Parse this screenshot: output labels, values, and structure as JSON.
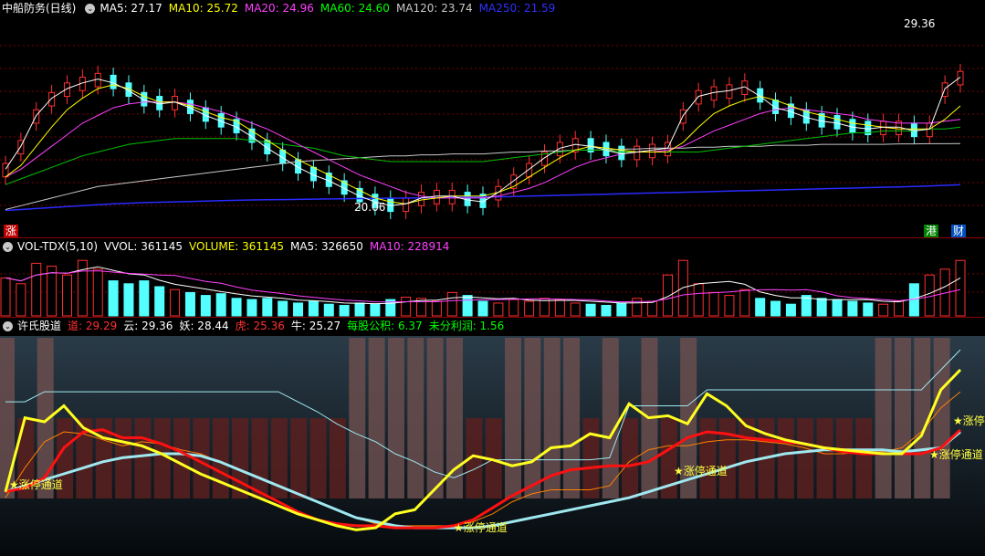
{
  "price_panel": {
    "stock": "中船防务(日线)",
    "ma": [
      {
        "label": "MA5: 27.17",
        "color": "#ffffff"
      },
      {
        "label": "MA10: 25.72",
        "color": "#ffff00"
      },
      {
        "label": "MA20: 24.96",
        "color": "#ff40ff"
      },
      {
        "label": "MA60: 24.60",
        "color": "#00ff00"
      },
      {
        "label": "MA120: 23.74",
        "color": "#c8c8c8"
      },
      {
        "label": "MA250: 21.59",
        "color": "#3030ff"
      }
    ],
    "high_label": "29.36",
    "low_label": "20.06",
    "tag_zhang": "涨",
    "tag_gang": "港",
    "tag_cai": "财"
  },
  "vol_panel": {
    "title": "VOL-TDX(5,10)",
    "items": [
      {
        "label": "VVOL: 361145",
        "color": "#ffffff"
      },
      {
        "label": "VOLUME: 361145",
        "color": "#ffff00"
      },
      {
        "label": "MA5: 326650",
        "color": "#ffffff"
      },
      {
        "label": "MA10: 228914",
        "color": "#ff40ff"
      }
    ]
  },
  "ind_panel": {
    "title": "许氏股道",
    "items": [
      {
        "label": "道: 29.29",
        "color": "#ff3030"
      },
      {
        "label": "云: 29.36",
        "color": "#ffffff"
      },
      {
        "label": "妖: 28.44",
        "color": "#ffffff"
      },
      {
        "label": "虎: 25.36",
        "color": "#ff3030"
      },
      {
        "label": "牛: 25.27",
        "color": "#ffffff"
      },
      {
        "label": "每股公积: 6.37",
        "color": "#00ff00"
      },
      {
        "label": "未分利润: 1.56",
        "color": "#00ff00"
      }
    ],
    "signal_label": "★涨停通道"
  },
  "chart_data": {
    "type": "line",
    "price": {
      "ma5": [
        22.4,
        23.6,
        25.2,
        26.1,
        26.6,
        26.9,
        27.1,
        26.9,
        26.5,
        26.0,
        25.8,
        25.9,
        25.6,
        25.2,
        24.9,
        24.6,
        24.1,
        23.5,
        23.0,
        22.5,
        22.1,
        21.8,
        21.4,
        21.0,
        20.7,
        20.5,
        20.6,
        20.9,
        21.0,
        21.0,
        20.8,
        20.7,
        21.2,
        21.8,
        22.4,
        23.0,
        23.5,
        23.7,
        23.6,
        23.4,
        23.2,
        23.3,
        23.4,
        23.5,
        25.2,
        26.2,
        26.4,
        26.5,
        26.7,
        26.2,
        25.6,
        25.4,
        25.1,
        24.9,
        24.8,
        24.6,
        24.5,
        24.6,
        24.6,
        24.4,
        24.5,
        26.6,
        27.2
      ],
      "ma10": [
        22.0,
        22.6,
        23.6,
        24.6,
        25.5,
        26.1,
        26.6,
        26.8,
        26.6,
        26.2,
        25.9,
        25.9,
        25.7,
        25.4,
        25.1,
        24.9,
        24.4,
        23.9,
        23.4,
        22.9,
        22.5,
        22.1,
        21.7,
        21.3,
        20.9,
        20.7,
        20.6,
        20.8,
        20.9,
        21.0,
        21.0,
        21.0,
        21.2,
        21.5,
        22.0,
        22.5,
        23.0,
        23.4,
        23.6,
        23.5,
        23.4,
        23.3,
        23.3,
        23.3,
        23.8,
        24.6,
        25.3,
        25.7,
        26.0,
        26.2,
        26.0,
        25.7,
        25.4,
        25.2,
        25.0,
        24.8,
        24.7,
        24.6,
        24.5,
        24.5,
        24.5,
        25.0,
        25.7
      ],
      "ma20": [
        22.0,
        22.4,
        23.0,
        23.6,
        24.2,
        24.8,
        25.2,
        25.6,
        25.8,
        25.9,
        25.9,
        25.9,
        25.8,
        25.6,
        25.4,
        25.1,
        24.8,
        24.5,
        24.1,
        23.7,
        23.3,
        22.9,
        22.5,
        22.1,
        21.8,
        21.5,
        21.2,
        21.0,
        20.9,
        20.9,
        20.9,
        20.9,
        21.0,
        21.2,
        21.4,
        21.7,
        22.1,
        22.5,
        22.8,
        23.0,
        23.2,
        23.3,
        23.3,
        23.4,
        23.6,
        24.0,
        24.4,
        24.7,
        25.0,
        25.3,
        25.5,
        25.6,
        25.5,
        25.4,
        25.3,
        25.2,
        25.0,
        24.9,
        24.8,
        24.8,
        24.8,
        24.9,
        25.0
      ],
      "ma60": [
        21.6,
        21.9,
        22.2,
        22.5,
        22.8,
        23.1,
        23.3,
        23.5,
        23.7,
        23.8,
        23.9,
        24.0,
        24.0,
        24.0,
        24.0,
        24.0,
        23.9,
        23.8,
        23.7,
        23.6,
        23.5,
        23.3,
        23.1,
        23.0,
        22.9,
        22.8,
        22.8,
        22.8,
        22.8,
        22.8,
        22.8,
        22.8,
        22.9,
        23.0,
        23.1,
        23.2,
        23.3,
        23.4,
        23.4,
        23.4,
        23.3,
        23.3,
        23.3,
        23.3,
        23.3,
        23.3,
        23.4,
        23.5,
        23.6,
        23.7,
        23.8,
        23.9,
        24.0,
        24.1,
        24.2,
        24.3,
        24.3,
        24.4,
        24.4,
        24.4,
        24.5,
        24.5,
        24.6
      ],
      "ma120": [
        20.3,
        20.5,
        20.7,
        20.9,
        21.1,
        21.3,
        21.5,
        21.6,
        21.7,
        21.8,
        21.9,
        22.0,
        22.1,
        22.2,
        22.3,
        22.4,
        22.5,
        22.6,
        22.7,
        22.8,
        22.85,
        22.9,
        22.95,
        23.0,
        23.05,
        23.1,
        23.1,
        23.15,
        23.15,
        23.2,
        23.2,
        23.2,
        23.25,
        23.3,
        23.3,
        23.35,
        23.35,
        23.4,
        23.4,
        23.4,
        23.45,
        23.45,
        23.5,
        23.5,
        23.5,
        23.55,
        23.55,
        23.6,
        23.6,
        23.6,
        23.65,
        23.65,
        23.65,
        23.7,
        23.7,
        23.7,
        23.7,
        23.7,
        23.72,
        23.72,
        23.73,
        23.73,
        23.74
      ],
      "ma250": [
        20.25,
        20.3,
        20.35,
        20.4,
        20.45,
        20.5,
        20.55,
        20.6,
        20.63,
        20.66,
        20.68,
        20.7,
        20.72,
        20.74,
        20.76,
        20.78,
        20.8,
        20.81,
        20.82,
        20.83,
        20.84,
        20.85,
        20.86,
        20.87,
        20.88,
        20.89,
        20.9,
        20.91,
        20.92,
        20.93,
        20.94,
        20.95,
        20.96,
        20.98,
        21.0,
        21.02,
        21.04,
        21.06,
        21.08,
        21.1,
        21.12,
        21.14,
        21.16,
        21.18,
        21.2,
        21.22,
        21.24,
        21.26,
        21.28,
        21.3,
        21.32,
        21.34,
        21.36,
        21.38,
        21.4,
        21.42,
        21.44,
        21.46,
        21.48,
        21.5,
        21.53,
        21.56,
        21.59
      ],
      "ylim": [
        19.8,
        29.7
      ]
    },
    "volume": {
      "values": [
        65,
        55,
        90,
        85,
        70,
        95,
        80,
        60,
        55,
        60,
        50,
        45,
        40,
        35,
        38,
        30,
        28,
        30,
        25,
        22,
        25,
        20,
        18,
        22,
        20,
        28,
        32,
        30,
        25,
        40,
        35,
        25,
        22,
        28,
        25,
        30,
        28,
        22,
        20,
        18,
        22,
        30,
        25,
        70,
        95,
        55,
        40,
        35,
        45,
        30,
        25,
        20,
        35,
        30,
        28,
        25,
        22,
        20,
        25,
        55,
        70,
        80,
        95
      ],
      "ylim": [
        0,
        100
      ]
    },
    "indicator": {
      "dao": [
        22.0,
        23.5,
        24.8,
        25.3,
        25.2,
        24.9,
        24.6,
        24.8,
        24.7,
        24.4,
        24.2,
        23.8,
        23.4,
        23.0,
        22.6,
        22.2,
        21.8,
        21.4,
        21.0,
        20.7,
        20.6,
        20.6,
        20.6,
        20.6,
        20.8,
        21.2,
        21.8,
        22.2,
        22.4,
        22.4,
        22.4,
        22.6,
        23.8,
        24.4,
        24.6,
        24.6,
        24.8,
        24.9,
        24.9,
        24.8,
        24.7,
        24.5,
        24.2,
        24.2,
        24.3,
        24.3,
        24.5,
        25.3,
        26.5,
        27.3
      ],
      "yun": [
        26.8,
        26.8,
        27.3,
        27.3,
        27.3,
        27.3,
        27.3,
        27.3,
        27.3,
        27.3,
        27.3,
        27.3,
        27.3,
        27.3,
        27.3,
        26.8,
        26.3,
        25.7,
        25.2,
        24.8,
        24.2,
        23.8,
        23.3,
        23.0,
        23.4,
        23.9,
        23.9,
        23.9,
        23.9,
        23.9,
        23.9,
        24.0,
        26.6,
        26.6,
        26.6,
        26.6,
        27.4,
        27.4,
        27.4,
        27.4,
        27.4,
        27.4,
        27.4,
        27.4,
        27.4,
        27.4,
        27.4,
        27.4,
        28.4,
        29.4
      ],
      "yao": [
        22.3,
        26.0,
        25.8,
        26.6,
        25.5,
        25.0,
        24.8,
        24.6,
        24.2,
        23.7,
        23.2,
        22.8,
        22.4,
        22.0,
        21.6,
        21.2,
        20.9,
        20.6,
        20.4,
        20.5,
        21.2,
        21.4,
        22.4,
        23.4,
        24.1,
        23.9,
        23.6,
        23.8,
        24.5,
        24.6,
        25.2,
        25.0,
        26.7,
        26.0,
        26.1,
        25.7,
        27.2,
        26.6,
        25.6,
        25.2,
        24.9,
        24.7,
        24.5,
        24.4,
        24.3,
        24.2,
        24.2,
        25.1,
        27.4,
        28.4
      ],
      "hu": [
        22.3,
        22.5,
        23.0,
        24.5,
        25.3,
        25.4,
        25.0,
        25.0,
        24.7,
        24.3,
        23.8,
        23.3,
        22.8,
        22.3,
        21.8,
        21.3,
        20.9,
        20.7,
        20.6,
        20.6,
        20.5,
        20.5,
        20.5,
        20.6,
        20.9,
        21.5,
        22.1,
        22.6,
        23.1,
        23.4,
        23.5,
        23.6,
        23.6,
        23.8,
        24.4,
        25.0,
        25.3,
        25.2,
        25.0,
        24.9,
        24.8,
        24.7,
        24.5,
        24.3,
        24.2,
        24.2,
        24.2,
        24.2,
        24.5,
        25.4
      ],
      "niu": [
        22.3,
        22.6,
        22.9,
        23.2,
        23.5,
        23.8,
        24.0,
        24.1,
        24.2,
        24.2,
        24.1,
        23.8,
        23.4,
        23.0,
        22.6,
        22.2,
        21.8,
        21.4,
        21.0,
        20.8,
        20.6,
        20.5,
        20.5,
        20.5,
        20.5,
        20.6,
        20.8,
        21.0,
        21.2,
        21.4,
        21.6,
        21.8,
        22.0,
        22.3,
        22.6,
        22.9,
        23.2,
        23.5,
        23.8,
        24.0,
        24.2,
        24.3,
        24.4,
        24.4,
        24.4,
        24.4,
        24.3,
        24.4,
        24.5,
        25.3
      ],
      "ylim": [
        19.5,
        30.0
      ]
    }
  }
}
